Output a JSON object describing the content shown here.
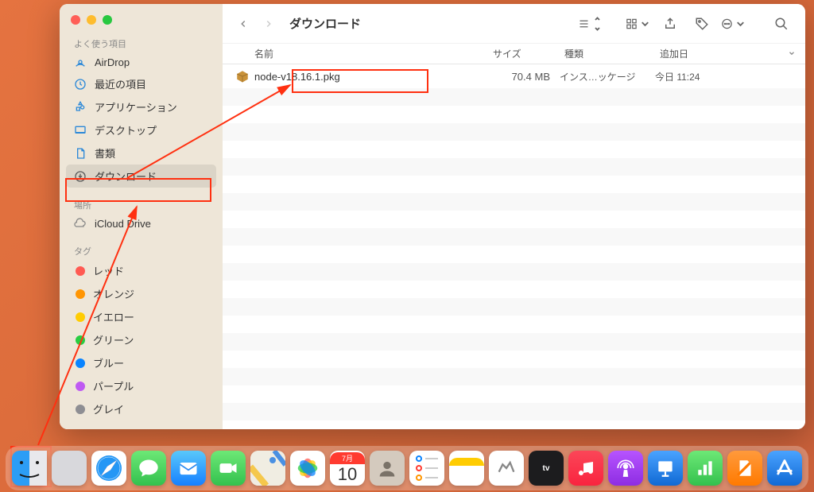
{
  "window": {
    "title": "ダウンロード"
  },
  "sidebar": {
    "favorites_header": "よく使う項目",
    "favorites": [
      {
        "label": "AirDrop",
        "icon": "airdrop"
      },
      {
        "label": "最近の項目",
        "icon": "clock"
      },
      {
        "label": "アプリケーション",
        "icon": "apps"
      },
      {
        "label": "デスクトップ",
        "icon": "desktop"
      },
      {
        "label": "書類",
        "icon": "document"
      },
      {
        "label": "ダウンロード",
        "icon": "download",
        "active": true
      }
    ],
    "locations_header": "場所",
    "locations": [
      {
        "label": "iCloud Drive",
        "icon": "cloud"
      }
    ],
    "tags_header": "タグ",
    "tags": [
      {
        "label": "レッド",
        "color": "#ff5a52"
      },
      {
        "label": "オレンジ",
        "color": "#ff9502"
      },
      {
        "label": "イエロー",
        "color": "#ffcc02"
      },
      {
        "label": "グリーン",
        "color": "#28cd41"
      },
      {
        "label": "ブルー",
        "color": "#0a84ff"
      },
      {
        "label": "パープル",
        "color": "#bf5af2"
      },
      {
        "label": "グレイ",
        "color": "#8e8e93"
      }
    ]
  },
  "columns": {
    "name": "名前",
    "size": "サイズ",
    "kind": "種類",
    "date": "追加日"
  },
  "files": [
    {
      "name": "node-v18.16.1.pkg",
      "size": "70.4 MB",
      "kind": "インス…ッケージ",
      "date": "今日 11:24"
    }
  ],
  "dock": {
    "items": [
      {
        "name": "finder",
        "bg": "linear-gradient(#2ea6ff,#1069d4)"
      },
      {
        "name": "launchpad",
        "bg": "#e8e8ec"
      },
      {
        "name": "safari",
        "bg": "linear-gradient(#4aa3ff,#1b6fe0)"
      },
      {
        "name": "messages",
        "bg": "linear-gradient(#5fe36a,#2fb94c)"
      },
      {
        "name": "mail",
        "bg": "linear-gradient(#5ac8fa,#1680ff)"
      },
      {
        "name": "facetime",
        "bg": "linear-gradient(#5fe36a,#2fb94c)"
      },
      {
        "name": "maps",
        "bg": "#f4f3f0"
      },
      {
        "name": "photos",
        "bg": "#ffffff"
      },
      {
        "name": "calendar",
        "bg": "#ffffff",
        "text": "10",
        "badge": "7月"
      },
      {
        "name": "contacts",
        "bg": "#d7cfc4"
      },
      {
        "name": "reminders",
        "bg": "#ffffff"
      },
      {
        "name": "notes",
        "bg": "#ffffff"
      },
      {
        "name": "freeform",
        "bg": "#ffffff"
      },
      {
        "name": "appletv",
        "bg": "#1c1c1e"
      },
      {
        "name": "music",
        "bg": "linear-gradient(#fb4658,#f9243f)"
      },
      {
        "name": "podcasts",
        "bg": "linear-gradient(#b654ff,#8e2de2)"
      },
      {
        "name": "keynote",
        "bg": "linear-gradient(#4aa3ff,#1069d4)"
      },
      {
        "name": "numbers",
        "bg": "linear-gradient(#5fe36a,#2fb94c)"
      },
      {
        "name": "pages",
        "bg": "linear-gradient(#ff9a3c,#ff7a00)"
      },
      {
        "name": "appstore",
        "bg": "linear-gradient(#4aa3ff,#1069d4)"
      }
    ]
  }
}
